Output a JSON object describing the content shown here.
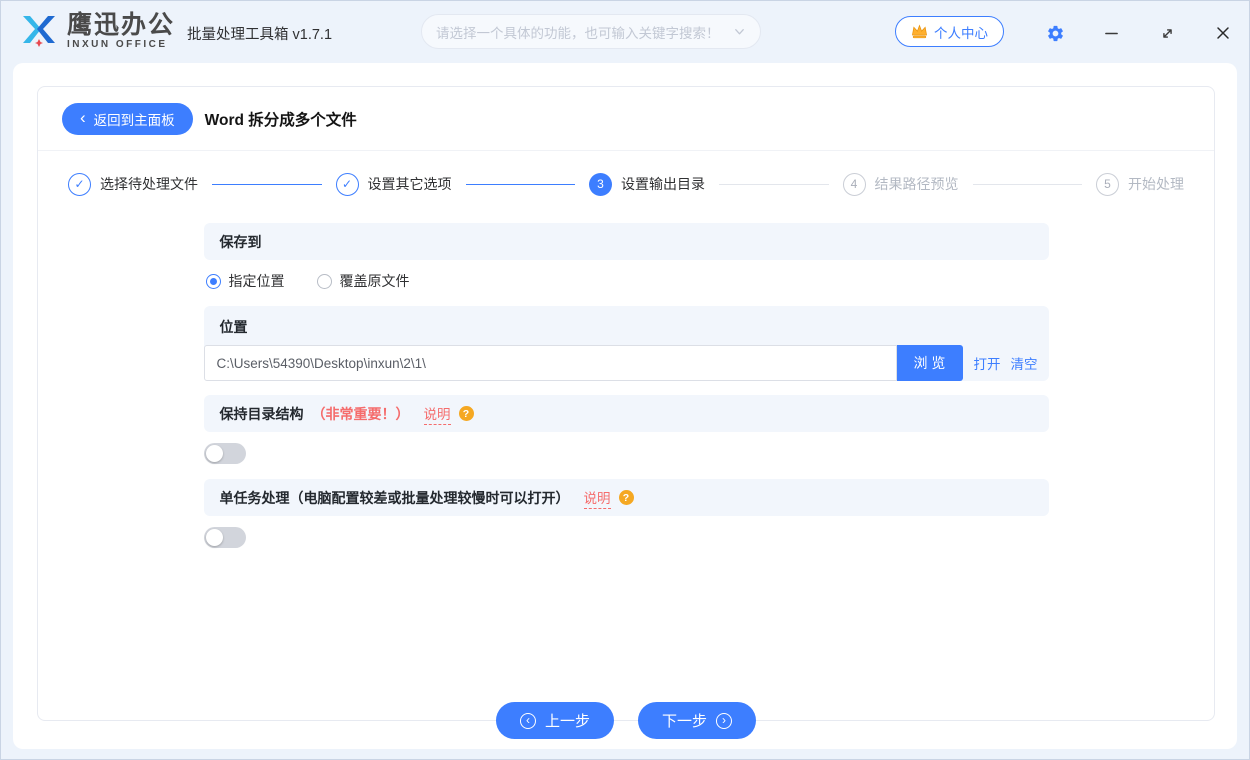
{
  "titlebar": {
    "logo_cn": "鹰迅办公",
    "logo_en": "INXUN OFFICE",
    "app_title": "批量处理工具箱 v1.7.1",
    "search_placeholder": "请选择一个具体的功能，也可输入关键字搜索！",
    "user_center_label": "个人中心"
  },
  "header": {
    "back_label": "返回到主面板",
    "page_title": "Word 拆分成多个文件"
  },
  "steps": [
    {
      "label": "选择待处理文件",
      "state": "done"
    },
    {
      "label": "设置其它选项",
      "state": "done"
    },
    {
      "label": "设置输出目录",
      "state": "active",
      "num": "3"
    },
    {
      "label": "结果路径预览",
      "state": "todo",
      "num": "4"
    },
    {
      "label": "开始处理",
      "state": "todo",
      "num": "5"
    }
  ],
  "form": {
    "save_to": {
      "header": "保存到",
      "option_specified": "指定位置",
      "option_overwrite": "覆盖原文件",
      "selected": "指定位置"
    },
    "location": {
      "header": "位置",
      "path": "C:\\Users\\54390\\Desktop\\inxun\\2\\1\\",
      "browse_label": "浏 览",
      "open_label": "打开",
      "clear_label": "清空"
    },
    "keep_structure": {
      "label": "保持目录结构",
      "important_note": "（非常重要！）",
      "help_label": "说明",
      "enabled": false
    },
    "single_task": {
      "label": "单任务处理（电脑配置较差或批量处理较慢时可以打开）",
      "help_label": "说明",
      "enabled": false
    }
  },
  "footer": {
    "prev_label": "上一步",
    "next_label": "下一步"
  },
  "colors": {
    "accent": "#3d7eff",
    "danger": "#f56c6c",
    "warning": "#f5a822"
  }
}
